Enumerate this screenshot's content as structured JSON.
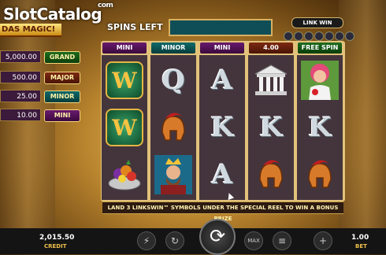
{
  "watermark": {
    "text": "SlotCatalog",
    "com": "com"
  },
  "title_banner": "DAS MAGIC!",
  "jackpots": [
    {
      "value": "5,000.00",
      "label": "GRAND"
    },
    {
      "value": "500.00",
      "label": "MAJOR"
    },
    {
      "value": "25.00",
      "label": "MINOR"
    },
    {
      "value": "10.00",
      "label": "MINI"
    }
  ],
  "spins_left_label": "SPINS LEFT",
  "linkwin_logo": "LINK WIN",
  "reel_headers": [
    "MINI",
    "MINOR",
    "MINI",
    "4.00",
    "FREE SPIN"
  ],
  "reels": [
    [
      "wild",
      "wild",
      "fruit-bowl"
    ],
    [
      "Q",
      "spartan-helmet",
      "king"
    ],
    [
      "A",
      "K",
      "A"
    ],
    [
      "temple",
      "K",
      "spartan-helmet"
    ],
    [
      "princess",
      "K",
      "spartan-helmet"
    ]
  ],
  "wild_letter": "W",
  "letters": {
    "Q": "Q",
    "A": "A",
    "K": "K"
  },
  "info_bar": "LAND 3 LINKSWIN™ SYMBOLS UNDER THE SPECIAL REEL TO WIN A BONUS PRIZE",
  "credit": {
    "value": "2,015.50",
    "label": "CREDIT"
  },
  "bet": {
    "value": "1.00",
    "label": "BET"
  },
  "controls": {
    "turbo": "⚡",
    "autoplay": "↻",
    "spin": "⟳",
    "max": "MAX",
    "paytable": "≡",
    "plus": "+",
    "minus": "−"
  },
  "colors": {
    "grand": "#1e6d1f",
    "major": "#7d2a12",
    "minor": "#106a6a",
    "mini": "#6a1a6e",
    "reel_bg": "#44353d"
  }
}
